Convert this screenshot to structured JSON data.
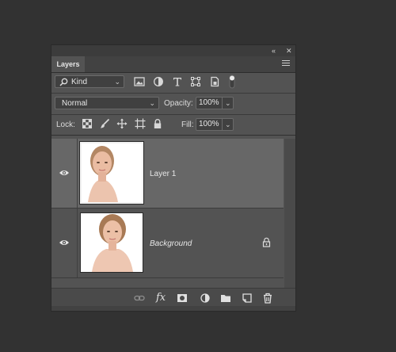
{
  "panel": {
    "collapse_icon": "double-chevron-left",
    "close_icon": "close",
    "tab_label": "Layers",
    "menu_icon": "hamburger-menu"
  },
  "filter_row": {
    "search_icon": "magnifier",
    "filter_value": "Kind",
    "icons": [
      "image-filter-icon",
      "adjustment-filter-icon",
      "type-filter-icon",
      "shape-filter-icon",
      "smart-object-filter-icon",
      "filter-toggle-icon"
    ]
  },
  "blend_row": {
    "blend_mode": "Normal",
    "opacity_label": "Opacity:",
    "opacity_value": "100%"
  },
  "lock_row": {
    "lock_label": "Lock:",
    "icons": [
      "lock-transparent-icon",
      "lock-image-icon",
      "lock-position-icon",
      "lock-artboard-icon",
      "lock-all-icon"
    ],
    "fill_label": "Fill:",
    "fill_value": "100%"
  },
  "layers": [
    {
      "name": "Layer 1",
      "visible": true,
      "selected": true,
      "locked": false
    },
    {
      "name": "Background",
      "visible": true,
      "selected": false,
      "locked": true
    }
  ],
  "bottom_icons": [
    "link-layers-icon",
    "fx-icon",
    "add-mask-icon",
    "adjustment-layer-icon",
    "group-folder-icon",
    "new-layer-icon",
    "delete-icon"
  ],
  "bottom_labels": {
    "fx": "fx"
  },
  "colors": {
    "panel": "#535353",
    "selected_row": "#676767",
    "background": "#323232"
  }
}
